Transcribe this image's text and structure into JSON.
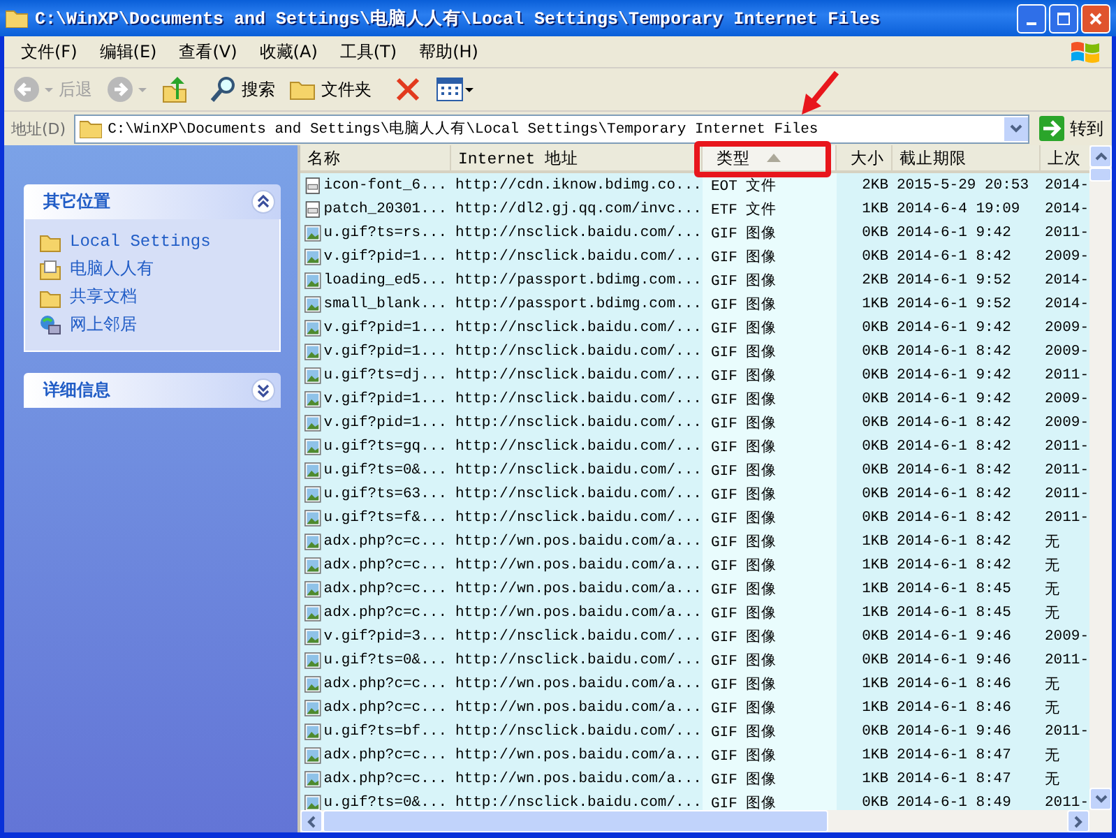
{
  "window": {
    "title": "C:\\WinXP\\Documents and Settings\\电脑人人有\\Local Settings\\Temporary Internet Files"
  },
  "menu": [
    "文件(F)",
    "编辑(E)",
    "查看(V)",
    "收藏(A)",
    "工具(T)",
    "帮助(H)"
  ],
  "toolbar": [
    {
      "kind": "back",
      "label": "后退",
      "disabled": true
    },
    {
      "kind": "forward",
      "disabled": true
    },
    {
      "kind": "up"
    },
    {
      "kind": "search",
      "label": "搜索"
    },
    {
      "kind": "folders",
      "label": "文件夹"
    },
    {
      "kind": "delete"
    },
    {
      "kind": "views"
    }
  ],
  "address": {
    "label": "地址(D)",
    "value": "C:\\WinXP\\Documents and Settings\\电脑人人有\\Local Settings\\Temporary Internet Files",
    "go": "转到"
  },
  "sidebar": [
    {
      "title": "其它位置",
      "expanded": true,
      "items": [
        {
          "kind": "folder",
          "label": "Local Settings"
        },
        {
          "kind": "documents",
          "label": "电脑人人有"
        },
        {
          "kind": "folder",
          "label": "共享文档"
        },
        {
          "kind": "network",
          "label": "网上邻居"
        }
      ]
    },
    {
      "title": "详细信息",
      "expanded": false
    }
  ],
  "table": {
    "columns": [
      {
        "label": "名称",
        "sorted": false
      },
      {
        "label": "Internet 地址",
        "sorted": false
      },
      {
        "label": "类型",
        "sorted": true
      },
      {
        "label": "大小",
        "sorted": false
      },
      {
        "label": "截止期限",
        "sorted": false
      },
      {
        "label": "上次",
        "sorted": false
      }
    ],
    "rows": [
      {
        "kind": "document",
        "name": "icon-font_6...",
        "url": "http://cdn.iknow.bdimg.co...",
        "type": "EOT 文件",
        "size": "2KB",
        "expires": "2015-5-29 20:53",
        "last": "2014-"
      },
      {
        "kind": "document",
        "name": "patch_20301...",
        "url": "http://dl2.gj.qq.com/invc...",
        "type": "ETF 文件",
        "size": "1KB",
        "expires": "2014-6-4 19:09",
        "last": "2014-"
      },
      {
        "kind": "image",
        "name": "u.gif?ts=rs...",
        "url": "http://nsclick.baidu.com/...",
        "type": "GIF 图像",
        "size": "0KB",
        "expires": "2014-6-1 9:42",
        "last": "2011-"
      },
      {
        "kind": "image",
        "name": "v.gif?pid=1...",
        "url": "http://nsclick.baidu.com/...",
        "type": "GIF 图像",
        "size": "0KB",
        "expires": "2014-6-1 8:42",
        "last": "2009-"
      },
      {
        "kind": "image",
        "name": "loading_ed5...",
        "url": "http://passport.bdimg.com...",
        "type": "GIF 图像",
        "size": "2KB",
        "expires": "2014-6-1 9:52",
        "last": "2014-"
      },
      {
        "kind": "image",
        "name": "small_blank...",
        "url": "http://passport.bdimg.com...",
        "type": "GIF 图像",
        "size": "1KB",
        "expires": "2014-6-1 9:52",
        "last": "2014-"
      },
      {
        "kind": "image",
        "name": "v.gif?pid=1...",
        "url": "http://nsclick.baidu.com/...",
        "type": "GIF 图像",
        "size": "0KB",
        "expires": "2014-6-1 9:42",
        "last": "2009-"
      },
      {
        "kind": "image",
        "name": "v.gif?pid=1...",
        "url": "http://nsclick.baidu.com/...",
        "type": "GIF 图像",
        "size": "0KB",
        "expires": "2014-6-1 8:42",
        "last": "2009-"
      },
      {
        "kind": "image",
        "name": "u.gif?ts=dj...",
        "url": "http://nsclick.baidu.com/...",
        "type": "GIF 图像",
        "size": "0KB",
        "expires": "2014-6-1 9:42",
        "last": "2011-"
      },
      {
        "kind": "image",
        "name": "v.gif?pid=1...",
        "url": "http://nsclick.baidu.com/...",
        "type": "GIF 图像",
        "size": "0KB",
        "expires": "2014-6-1 9:42",
        "last": "2009-"
      },
      {
        "kind": "image",
        "name": "v.gif?pid=1...",
        "url": "http://nsclick.baidu.com/...",
        "type": "GIF 图像",
        "size": "0KB",
        "expires": "2014-6-1 8:42",
        "last": "2009-"
      },
      {
        "kind": "image",
        "name": "u.gif?ts=gq...",
        "url": "http://nsclick.baidu.com/...",
        "type": "GIF 图像",
        "size": "0KB",
        "expires": "2014-6-1 8:42",
        "last": "2011-"
      },
      {
        "kind": "image",
        "name": "u.gif?ts=0&...",
        "url": "http://nsclick.baidu.com/...",
        "type": "GIF 图像",
        "size": "0KB",
        "expires": "2014-6-1 8:42",
        "last": "2011-"
      },
      {
        "kind": "image",
        "name": "u.gif?ts=63...",
        "url": "http://nsclick.baidu.com/...",
        "type": "GIF 图像",
        "size": "0KB",
        "expires": "2014-6-1 8:42",
        "last": "2011-"
      },
      {
        "kind": "image",
        "name": "u.gif?ts=f&...",
        "url": "http://nsclick.baidu.com/...",
        "type": "GIF 图像",
        "size": "0KB",
        "expires": "2014-6-1 8:42",
        "last": "2011-"
      },
      {
        "kind": "image",
        "name": "adx.php?c=c...",
        "url": "http://wn.pos.baidu.com/a...",
        "type": "GIF 图像",
        "size": "1KB",
        "expires": "2014-6-1 8:42",
        "last": "无"
      },
      {
        "kind": "image",
        "name": "adx.php?c=c...",
        "url": "http://wn.pos.baidu.com/a...",
        "type": "GIF 图像",
        "size": "1KB",
        "expires": "2014-6-1 8:42",
        "last": "无"
      },
      {
        "kind": "image",
        "name": "adx.php?c=c...",
        "url": "http://wn.pos.baidu.com/a...",
        "type": "GIF 图像",
        "size": "1KB",
        "expires": "2014-6-1 8:45",
        "last": "无"
      },
      {
        "kind": "image",
        "name": "adx.php?c=c...",
        "url": "http://wn.pos.baidu.com/a...",
        "type": "GIF 图像",
        "size": "1KB",
        "expires": "2014-6-1 8:45",
        "last": "无"
      },
      {
        "kind": "image",
        "name": "v.gif?pid=3...",
        "url": "http://nsclick.baidu.com/...",
        "type": "GIF 图像",
        "size": "0KB",
        "expires": "2014-6-1 9:46",
        "last": "2009-"
      },
      {
        "kind": "image",
        "name": "u.gif?ts=0&...",
        "url": "http://nsclick.baidu.com/...",
        "type": "GIF 图像",
        "size": "0KB",
        "expires": "2014-6-1 9:46",
        "last": "2011-"
      },
      {
        "kind": "image",
        "name": "adx.php?c=c...",
        "url": "http://wn.pos.baidu.com/a...",
        "type": "GIF 图像",
        "size": "1KB",
        "expires": "2014-6-1 8:46",
        "last": "无"
      },
      {
        "kind": "image",
        "name": "adx.php?c=c...",
        "url": "http://wn.pos.baidu.com/a...",
        "type": "GIF 图像",
        "size": "1KB",
        "expires": "2014-6-1 8:46",
        "last": "无"
      },
      {
        "kind": "image",
        "name": "u.gif?ts=bf...",
        "url": "http://nsclick.baidu.com/...",
        "type": "GIF 图像",
        "size": "0KB",
        "expires": "2014-6-1 9:46",
        "last": "2011-"
      },
      {
        "kind": "image",
        "name": "adx.php?c=c...",
        "url": "http://wn.pos.baidu.com/a...",
        "type": "GIF 图像",
        "size": "1KB",
        "expires": "2014-6-1 8:47",
        "last": "无"
      },
      {
        "kind": "image",
        "name": "adx.php?c=c...",
        "url": "http://wn.pos.baidu.com/a...",
        "type": "GIF 图像",
        "size": "1KB",
        "expires": "2014-6-1 8:47",
        "last": "无"
      },
      {
        "kind": "image",
        "name": "u.gif?ts=0&...",
        "url": "http://nsclick.baidu.com/...",
        "type": "GIF 图像",
        "size": "0KB",
        "expires": "2014-6-1 8:49",
        "last": "2011-"
      }
    ]
  }
}
